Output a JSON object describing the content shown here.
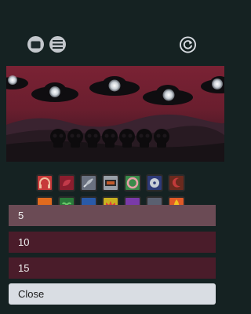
{
  "toolbar": {
    "window_icon": "window-icon",
    "menu_icon": "hamburger-menu-icon",
    "reset_icon": "refresh-icon"
  },
  "theme": {
    "background": "#152222",
    "option_selected": "#6b4b55",
    "option_default": "#4a1c2a",
    "close_bg": "#d9dde3"
  },
  "tile_colors": {
    "row1": [
      "#c73a3a",
      "#8a1e2e",
      "#6a7180",
      "#9aa0a8",
      "#3a8a4a",
      "#2e3a78",
      "#6a2a1e"
    ],
    "row2": [
      "#e06a1e",
      "#2a7a3a",
      "#2a5aa8",
      "#c8b020",
      "#7a3aa8",
      "#5a6070",
      "#e05a28"
    ]
  },
  "menu": {
    "options": [
      "5",
      "10",
      "15"
    ],
    "selected": "5",
    "close_label": "Close"
  }
}
